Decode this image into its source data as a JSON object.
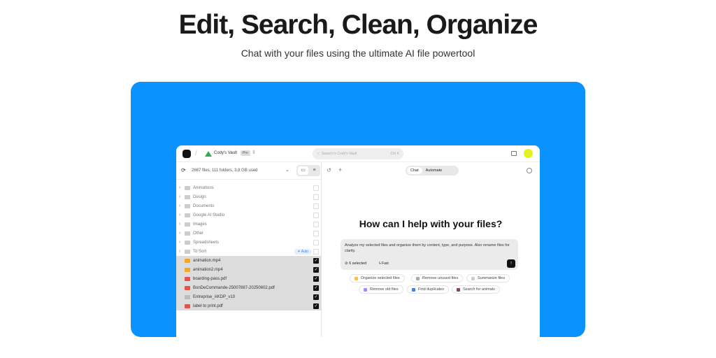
{
  "hero": {
    "title": "Edit, Search, Clean, Organize",
    "subtitle": "Chat with your files using the ultimate AI file powertool"
  },
  "header": {
    "vault": "Cody's Vault",
    "plan": "Pro",
    "search_placeholder": "Search in Cody's Vault",
    "shortcut": "Ctrl K"
  },
  "sidebar": {
    "stats": "2687 files, 111 folders, 3.8 GB used",
    "auto_label": "Auto",
    "folders": [
      "Animations",
      "Design",
      "Documents",
      "Google AI Studio",
      "Images",
      "Other",
      "Spreadsheets",
      "To Sort"
    ],
    "files": [
      {
        "name": "animation.mp4",
        "type": "video"
      },
      {
        "name": "animation2.mp4",
        "type": "video"
      },
      {
        "name": "boarding-pass.pdf",
        "type": "pdf"
      },
      {
        "name": "BonDeCommande-25007887-20250602.pdf",
        "type": "pdf"
      },
      {
        "name": "Entreprise_AKDP_v10",
        "type": "doc"
      },
      {
        "name": "label to print.pdf",
        "type": "pdf"
      }
    ]
  },
  "chat": {
    "tab_chat": "Chat",
    "tab_automate": "Automate",
    "heading": "How can I help with your files?",
    "prompt": "Analyze my selected files and organize them by content, type, and purpose. Also rename files for clarity.",
    "selected": "6 selected",
    "mode": "Fast",
    "suggestions": [
      "Organize selected files",
      "Remove unused files",
      "Summarize files",
      "Remove old files",
      "Find duplicates",
      "Search for animals"
    ]
  },
  "colors": {
    "brand_blue": "#0a93ff"
  }
}
